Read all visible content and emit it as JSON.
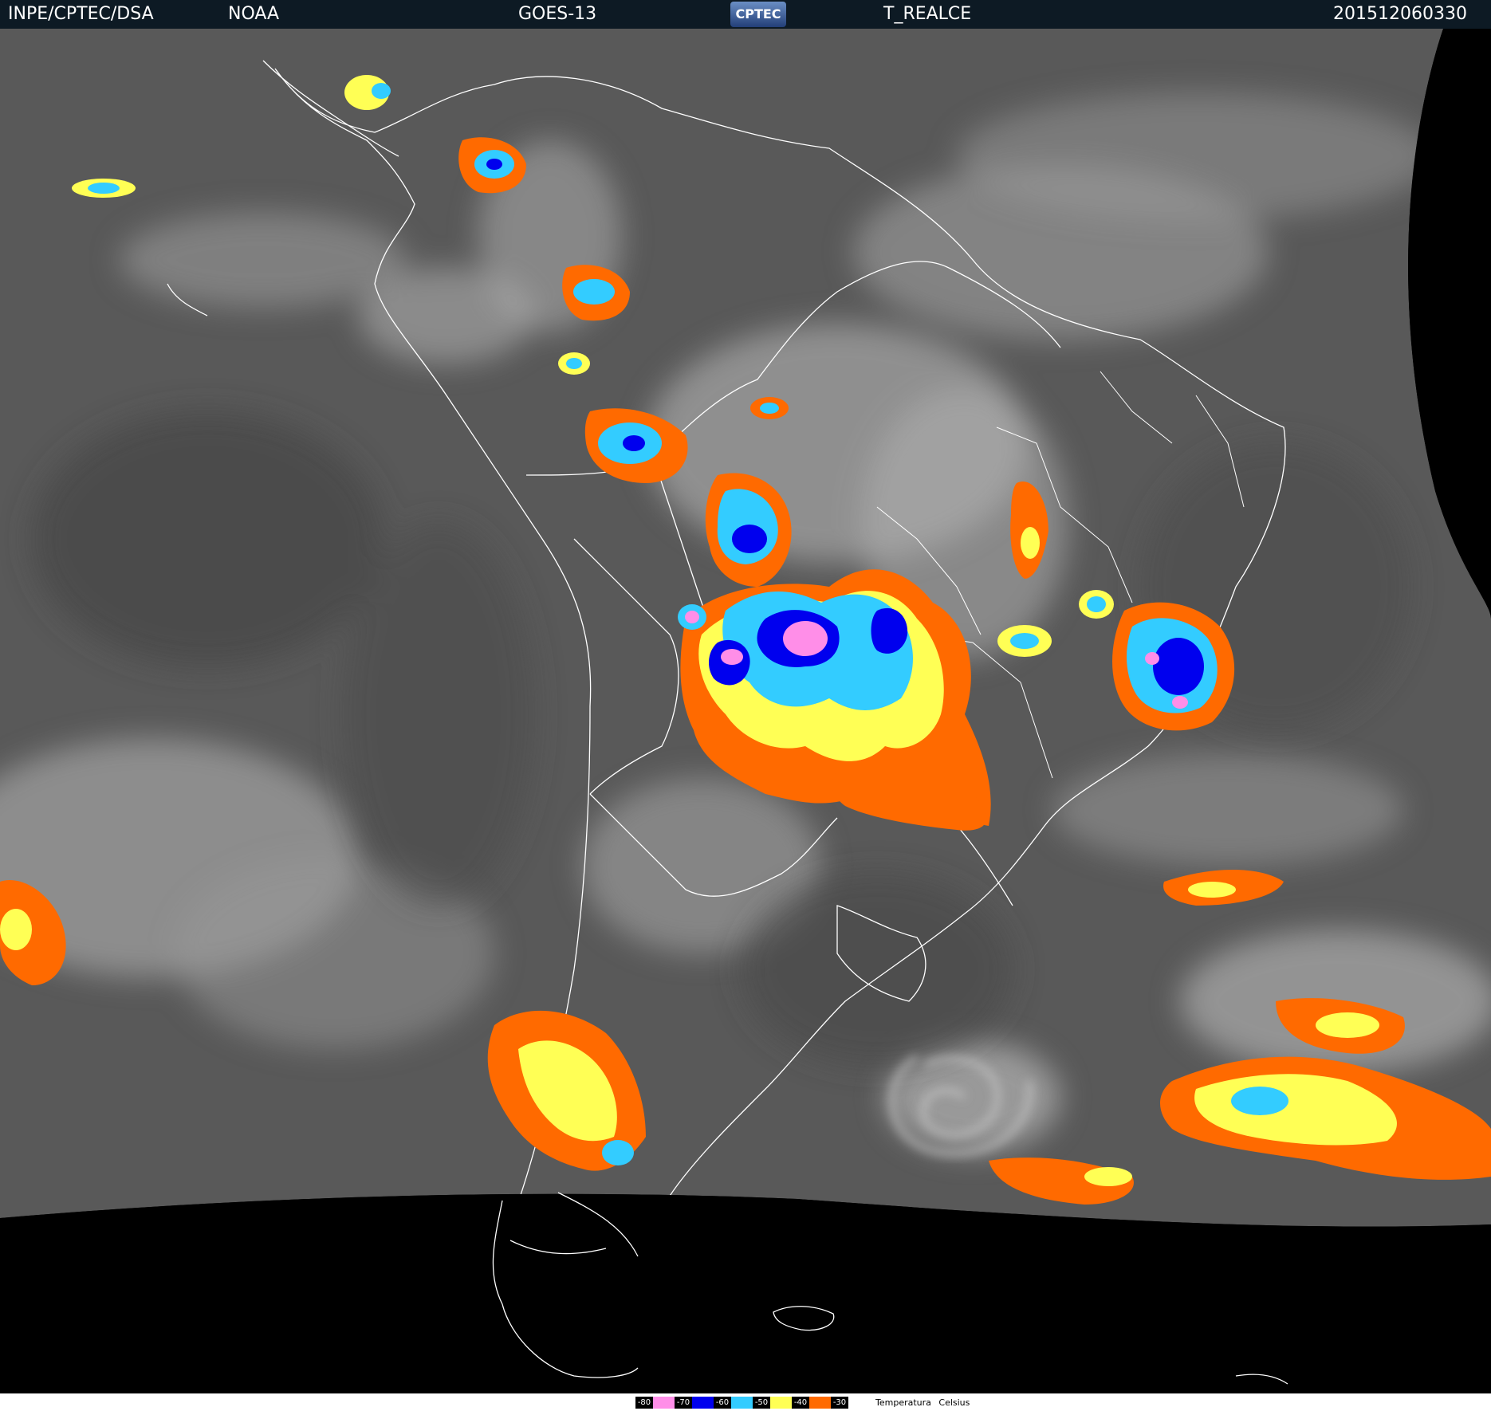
{
  "header": {
    "institution": "INPE/CPTEC/DSA",
    "agency": "NOAA",
    "satellite": "GOES-13",
    "logo_text": "CPTEC",
    "product": "T_REALCE",
    "timestamp": "201512060330"
  },
  "legend": {
    "title": "Temperatura  Celsius",
    "bins": [
      {
        "label": "-80",
        "color": "#ff8ee8"
      },
      {
        "label": "-70",
        "color": "#0000ee"
      },
      {
        "label": "-60",
        "color": "#33ccff"
      },
      {
        "label": "-50",
        "color": "#ffff55"
      },
      {
        "label": "-40",
        "color": "#ff6a00"
      },
      {
        "label": "-30",
        "color": ""
      }
    ]
  },
  "colors": {
    "background_gray": "#5a5a5a",
    "space": "#000000",
    "borders": "#ffffff"
  }
}
